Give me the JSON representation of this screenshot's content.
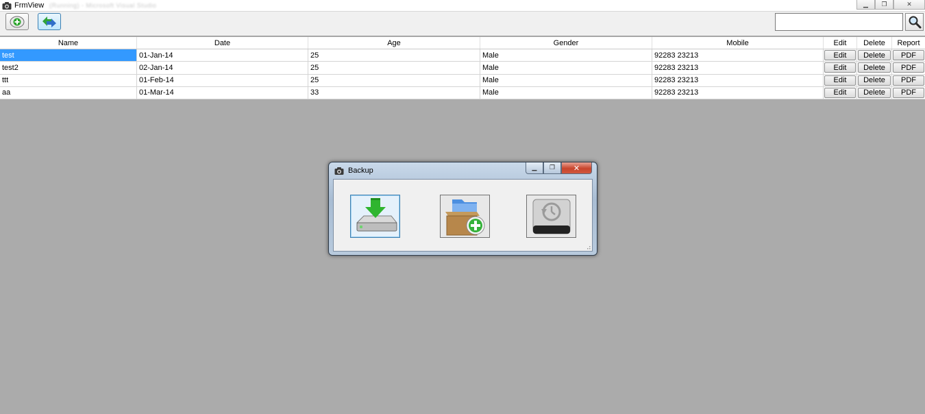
{
  "window": {
    "title": "FrmView",
    "title_suffix_blurred": "(Running) - Microsoft Visual Studio",
    "controls": {
      "minimize": "▁",
      "restore": "❐",
      "close": "✕"
    }
  },
  "toolbar": {
    "add_button_icon": "add-plus-icon",
    "sync_button_icon": "sync-arrows-icon",
    "search": {
      "value": "",
      "placeholder": ""
    },
    "search_button_icon": "magnifier-icon"
  },
  "grid": {
    "columns": [
      "Name",
      "Date",
      "Age",
      "Gender",
      "Mobile",
      "Edit",
      "Delete",
      "Report"
    ],
    "button_labels": {
      "edit": "Edit",
      "delete": "Delete",
      "report": "PDF"
    },
    "rows": [
      {
        "name": "test",
        "date": "01-Jan-14",
        "age": "25",
        "gender": "Male",
        "mobile": "92283 23213"
      },
      {
        "name": "test2",
        "date": "02-Jan-14",
        "age": "25",
        "gender": "Male",
        "mobile": "92283 23213"
      },
      {
        "name": "ttt",
        "date": "01-Feb-14",
        "age": "25",
        "gender": "Male",
        "mobile": "92283 23213"
      },
      {
        "name": "aa",
        "date": "01-Mar-14",
        "age": "33",
        "gender": "Male",
        "mobile": "92283 23213"
      }
    ],
    "selected_row": 0,
    "selection_color": "#3399ff"
  },
  "dialog": {
    "title": "Backup",
    "controls": {
      "minimize": "▁",
      "restore": "❐",
      "close": "✕"
    },
    "buttons": [
      {
        "icon": "backup-drive-download-icon",
        "focused": true
      },
      {
        "icon": "add-folder-box-icon",
        "focused": false
      },
      {
        "icon": "restore-drive-icon",
        "focused": false
      }
    ]
  },
  "colors": {
    "workspace": "#ababab",
    "accent": "#3399ff",
    "close_red": "#c8452c"
  }
}
